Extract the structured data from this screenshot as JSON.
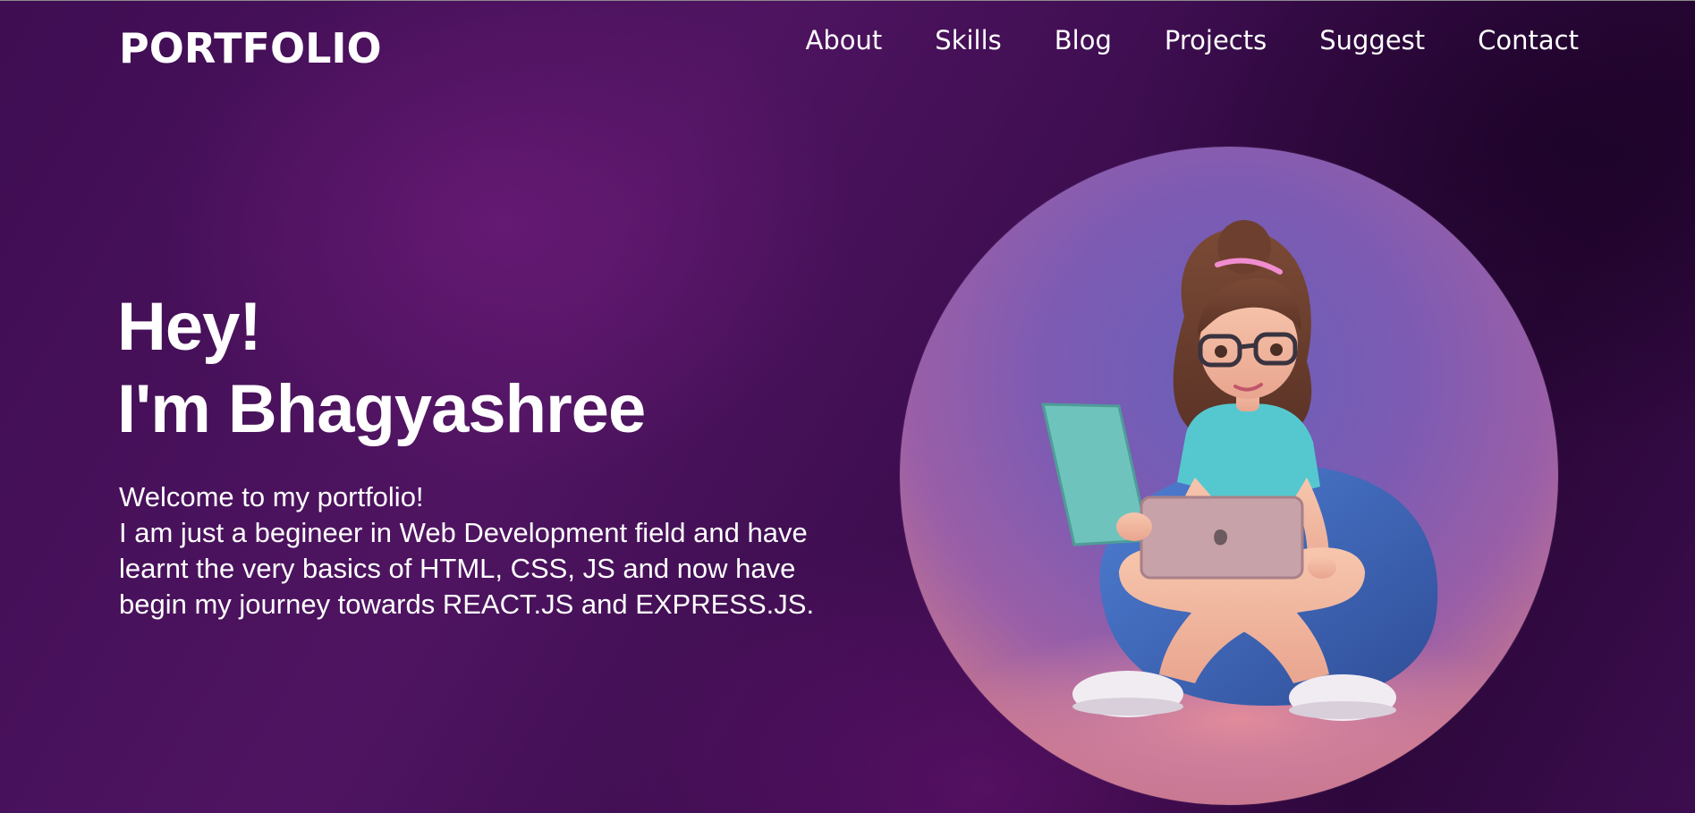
{
  "brand": {
    "logo_text": "PORTFOLIO"
  },
  "nav": {
    "items": [
      {
        "label": "About"
      },
      {
        "label": "Skills"
      },
      {
        "label": "Blog"
      },
      {
        "label": "Projects"
      },
      {
        "label": "Suggest"
      },
      {
        "label": "Contact"
      }
    ]
  },
  "hero": {
    "greeting": "Hey!",
    "name_line": "I'm Bhagyashree",
    "intro_lines": [
      "Welcome to my portfolio!",
      "I am just a begineer in Web Development field and have",
      "learnt the very basics of HTML, CSS, JS and now have",
      "begin my journey towards REACT.JS and EXPRESS.JS."
    ]
  },
  "colors": {
    "background": "#4a1260",
    "text": "#ffffff",
    "laptop": "#6fc3bd",
    "shirt": "#55c8cf",
    "beanbag": "#3f5da8"
  },
  "illustration": {
    "icon": "girl-with-laptop-illustration"
  }
}
